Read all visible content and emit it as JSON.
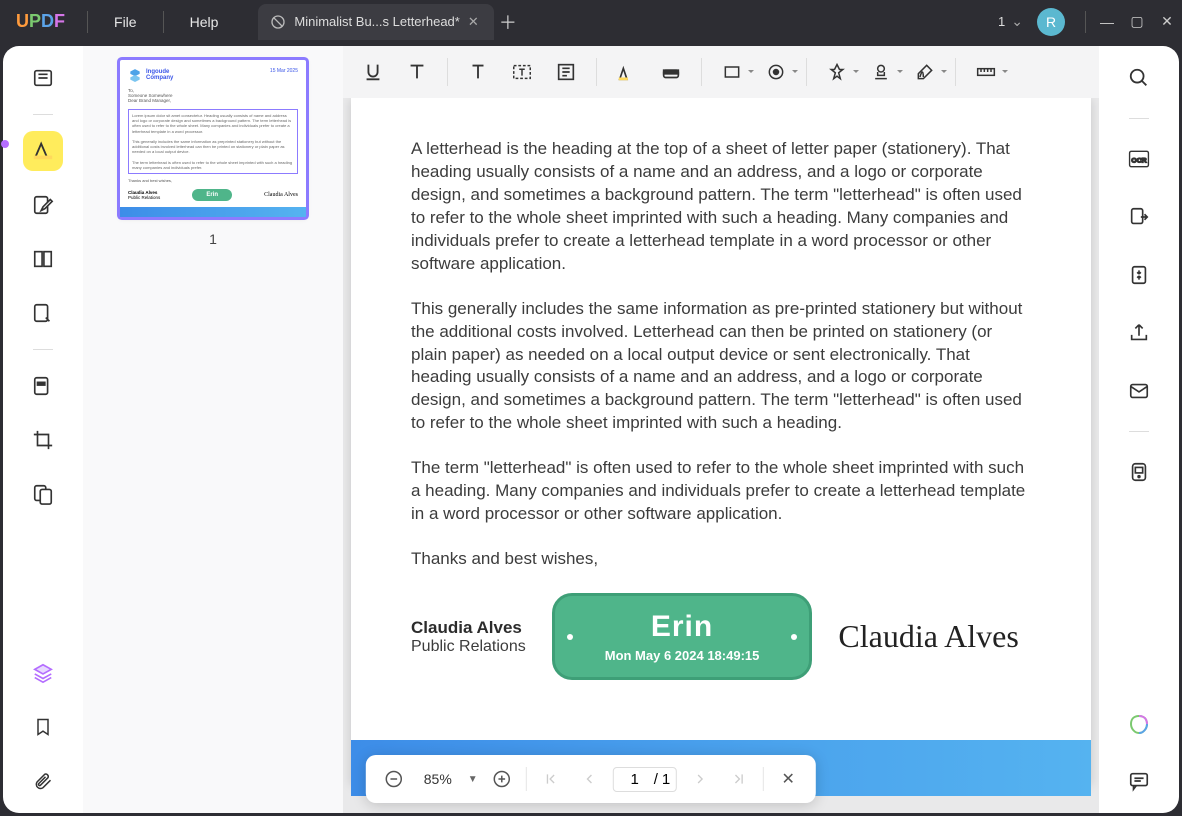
{
  "app": {
    "logo": "UPDF"
  },
  "menu": {
    "file": "File",
    "help": "Help"
  },
  "tab": {
    "title": "Minimalist Bu...s Letterhead*"
  },
  "titlebar": {
    "page_indicator": "1",
    "avatar_letter": "R"
  },
  "thumbnail": {
    "number": "1",
    "company_line1": "Ingoude",
    "company_line2": "Company",
    "date": "15 Mar 2025",
    "stamp_name": "Erin",
    "sig": "Claudia Alves"
  },
  "doc": {
    "p1": "A letterhead is the heading at the top of a sheet of letter paper (stationery). That heading usually consists of a name and an address, and a logo or corporate design, and sometimes a background pattern. The term \"letterhead\" is often used to refer to the whole sheet imprinted with such a heading. Many companies and individuals prefer to create a letterhead template in a word processor or other software application.",
    "p2": "This generally includes the same information as pre-printed stationery but without the additional costs involved. Letterhead can then be printed on stationery (or plain paper) as needed on a local output device or sent electronically. That heading usually consists of a name and an address, and a logo or corporate design, and sometimes a background pattern. The term \"letterhead\" is often used to refer to the whole sheet imprinted with such a heading.",
    "p3": "The term \"letterhead\" is often used to refer to the whole sheet imprinted with such a heading. Many companies and individuals prefer to create a letterhead template in a word processor or other software application.",
    "closing": "Thanks and best wishes,",
    "name": "Claudia Alves",
    "role": "Public Relations",
    "stamp_name": "Erin",
    "stamp_date": "Mon May 6 2024 18:49:15",
    "signature": "Claudia Alves"
  },
  "nav": {
    "zoom": "85%",
    "page_current": "1",
    "page_total": "1",
    "page_sep": "/"
  }
}
